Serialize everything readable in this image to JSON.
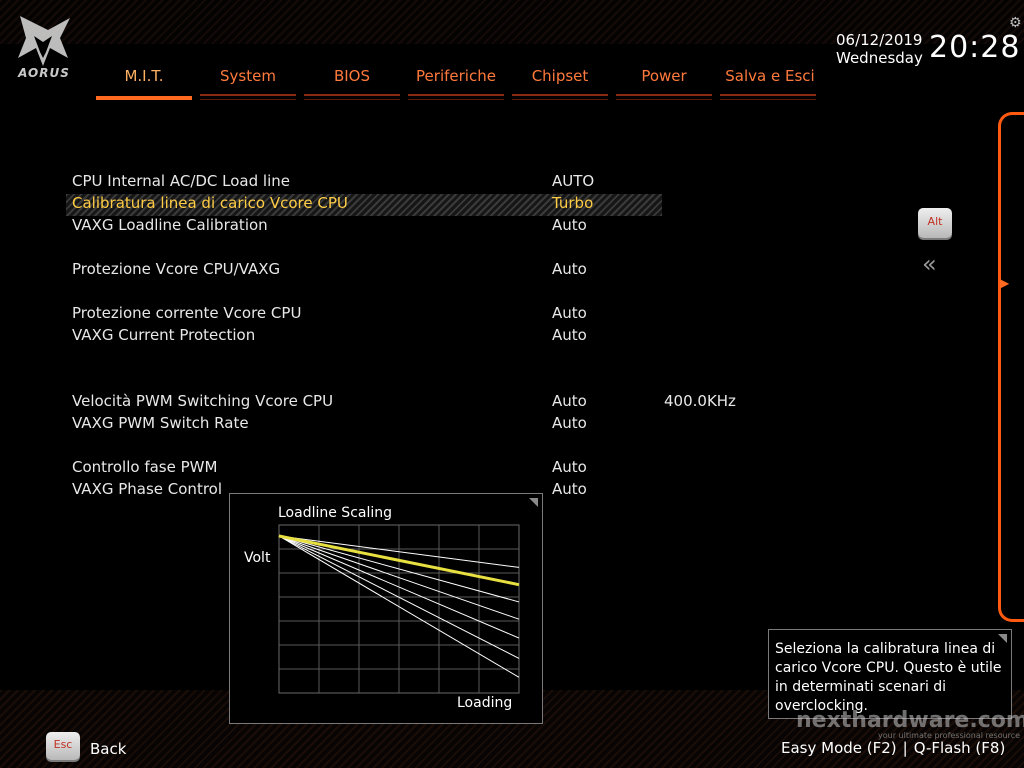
{
  "logo": {
    "text": "AORUS"
  },
  "tabs": [
    {
      "label": "M.I.T.",
      "active": true
    },
    {
      "label": "System",
      "active": false
    },
    {
      "label": "BIOS",
      "active": false
    },
    {
      "label": "Periferiche",
      "active": false
    },
    {
      "label": "Chipset",
      "active": false
    },
    {
      "label": "Power",
      "active": false
    },
    {
      "label": "Salva e Esci",
      "active": false
    }
  ],
  "datetime": {
    "date": "06/12/2019",
    "day": "Wednesday",
    "time": "20:28"
  },
  "icons": {
    "settings": "gear-icon",
    "logo": "aorus-eagle-icon",
    "collapse": "double-chevron-left-icon",
    "panel_toggle": "triangle-right-icon"
  },
  "settings": [
    {
      "label": "CPU Internal AC/DC Load line",
      "value": "AUTO",
      "extra": "",
      "selected": false
    },
    {
      "label": "Calibratura linea di carico Vcore CPU",
      "value": "Turbo",
      "extra": "",
      "selected": true
    },
    {
      "label": "VAXG Loadline Calibration",
      "value": "Auto",
      "extra": "",
      "selected": false
    },
    {
      "label": "Protezione Vcore CPU/VAXG",
      "value": "Auto",
      "extra": "",
      "selected": false
    },
    {
      "label": "Protezione corrente Vcore CPU",
      "value": "Auto",
      "extra": "",
      "selected": false
    },
    {
      "label": "VAXG Current Protection",
      "value": "Auto",
      "extra": "",
      "selected": false
    },
    {
      "label": "Velocità PWM Switching Vcore CPU",
      "value": "Auto",
      "extra": "400.0KHz",
      "selected": false
    },
    {
      "label": "VAXG PWM Switch Rate",
      "value": "Auto",
      "extra": "",
      "selected": false
    },
    {
      "label": "Controllo fase PWM",
      "value": "Auto",
      "extra": "",
      "selected": false
    },
    {
      "label": "VAXG Phase Control",
      "value": "Auto",
      "extra": "",
      "selected": false
    }
  ],
  "keys": {
    "alt": "Alt",
    "esc": "Esc"
  },
  "chart": {
    "title": "Loadline Scaling",
    "ylabel": "Volt",
    "xlabel": "Loading",
    "highlight_color": "#e8e040",
    "line_color": "#ffffff"
  },
  "chart_data": {
    "type": "line",
    "title": "Loadline Scaling",
    "xlabel": "Loading",
    "ylabel": "Volt",
    "x": [
      0,
      1
    ],
    "series": [
      {
        "values": [
          1.0,
          0.69
        ],
        "highlighted": true
      },
      {
        "values": [
          1.0,
          0.8
        ]
      },
      {
        "values": [
          1.0,
          0.58
        ]
      },
      {
        "values": [
          1.0,
          0.47
        ]
      },
      {
        "values": [
          1.0,
          0.35
        ]
      },
      {
        "values": [
          1.0,
          0.22
        ]
      },
      {
        "values": [
          1.0,
          0.1
        ]
      }
    ],
    "xlim": [
      0,
      1
    ],
    "ylim": [
      0,
      1.07
    ],
    "grid": true
  },
  "help": {
    "text": "Seleziona la calibratura linea di carico Vcore CPU. Questo è utile in determinati scenari di overclocking."
  },
  "watermark": {
    "brand": "nexthardware.com",
    "tagline": "your ultimate professional resource"
  },
  "bottom": {
    "back_label": "Back",
    "easy_mode": "Easy Mode (F2)",
    "separator": "|",
    "qflash": "Q-Flash (F8)"
  },
  "colors": {
    "accent": "#ff6a20",
    "selected_text": "#ffcc44",
    "tab_text": "#ff7a3c"
  }
}
